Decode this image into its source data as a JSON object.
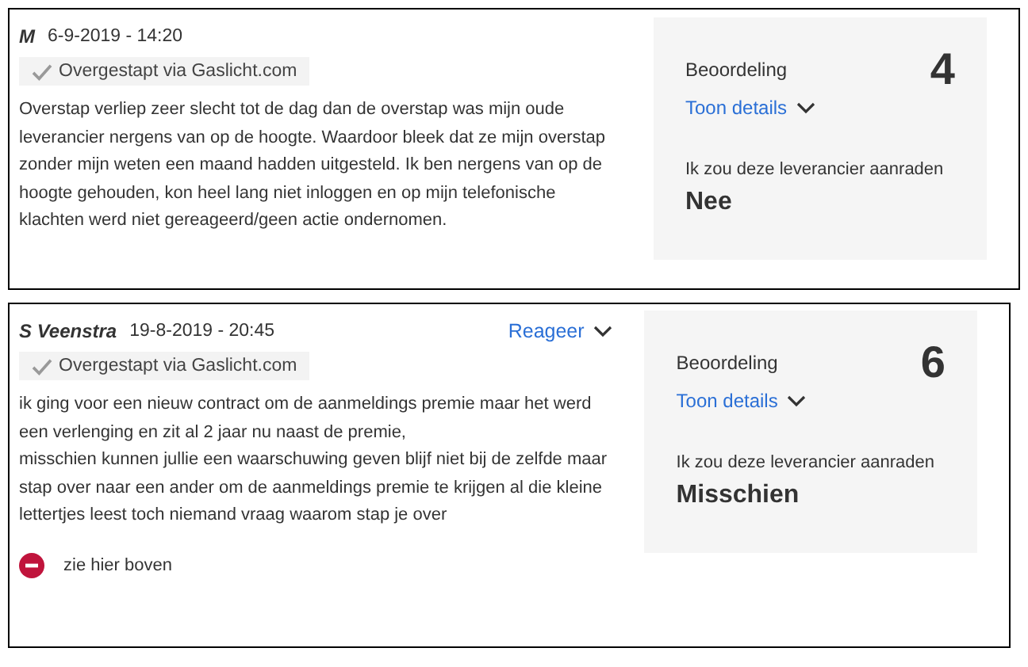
{
  "reviews": [
    {
      "author": "M",
      "date": "6-9-2019 - 14:20",
      "badge": "Overgestapt via Gaslicht.com",
      "text": "Overstap verliep zeer slecht tot de dag dan de overstap was mijn oude leverancier nergens van op de hoogte. Waardoor bleek dat ze mijn overstap zonder mijn weten een maand hadden uitgesteld. Ik ben nergens van op de hoogte gehouden, kon heel lang niet inloggen en op mijn telefonische klachten werd niet gereageerd/geen actie ondernomen.",
      "rating_label": "Beoordeling",
      "rating": "4",
      "details_link": "Toon details",
      "recommend_label": "Ik zou deze leverancier aanraden",
      "recommend": "Nee"
    },
    {
      "author": "S Veenstra",
      "date": "19-8-2019 - 20:45",
      "reply_link": "Reageer",
      "badge": "Overgestapt via Gaslicht.com",
      "text": "ik ging voor een nieuw contract om de aanmeldings premie maar het werd een verlenging en zit al 2 jaar nu naast de premie,\nmisschien kunnen jullie een waarschuwing geven blijf niet bij de zelfde maar stap over naar een ander om de aanmeldings premie te krijgen al die kleine lettertjes leest toch niemand vraag waarom stap je over",
      "points": [
        {
          "kind": "con",
          "text": "zie hier boven"
        }
      ],
      "rating_label": "Beoordeling",
      "rating": "6",
      "details_link": "Toon details",
      "recommend_label": "Ik zou deze leverancier aanraden",
      "recommend": "Misschien"
    }
  ]
}
